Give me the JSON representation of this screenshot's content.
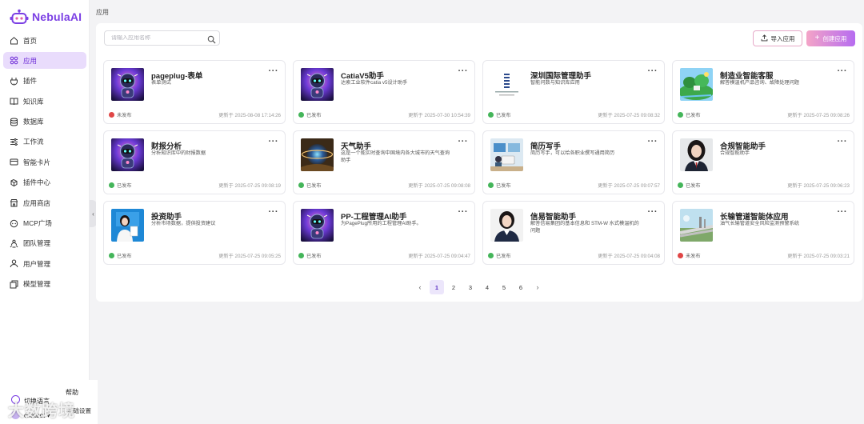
{
  "app": {
    "brand": "NebulaAI"
  },
  "sidebar": {
    "items": [
      {
        "label": "首页",
        "icon": "home-icon",
        "active": false
      },
      {
        "label": "应用",
        "icon": "apps-icon",
        "active": true
      },
      {
        "label": "插件",
        "icon": "plug-icon",
        "active": false
      },
      {
        "label": "知识库",
        "icon": "book-icon",
        "active": false
      },
      {
        "label": "数据库",
        "icon": "database-icon",
        "active": false
      },
      {
        "label": "工作流",
        "icon": "workflow-icon",
        "active": false
      },
      {
        "label": "智能卡片",
        "icon": "card-icon",
        "active": false
      },
      {
        "label": "插件中心",
        "icon": "plugin-center-icon",
        "active": false
      },
      {
        "label": "应用商店",
        "icon": "store-icon",
        "active": false
      },
      {
        "label": "MCP广场",
        "icon": "mcp-icon",
        "active": false
      },
      {
        "label": "团队管理",
        "icon": "team-icon",
        "active": false
      },
      {
        "label": "用户管理",
        "icon": "user-icon",
        "active": false
      },
      {
        "label": "模型管理",
        "icon": "model-icon",
        "active": false
      }
    ],
    "help_label": "帮助",
    "language_label": "切换语言",
    "user_name": "chatbot",
    "settings_label": "基础设置"
  },
  "watermark": "大数跨境",
  "breadcrumb": "应用",
  "search": {
    "placeholder": "请输入应用名称"
  },
  "toolbar": {
    "import_label": "导入应用",
    "create_label": "创建应用"
  },
  "colors": {
    "brand": "#7b3fe4",
    "published": "#44b55a",
    "unpublished": "#e04646",
    "active_nav_bg": "#e9dcfc"
  },
  "cards": [
    {
      "title": "pageplug-表单",
      "desc": "表单测试",
      "status": "未发布",
      "published": false,
      "updated": "更新于 2025-08-08 17:14:26",
      "image": "robot"
    },
    {
      "title": "CatiaV5助手",
      "desc": "达索工业软件catia v5设计助手",
      "status": "已发布",
      "published": true,
      "updated": "更新于 2025-07-30 10:54:39",
      "image": "robot"
    },
    {
      "title": "深圳国际管理助手",
      "desc": "智能问数与知识库应用",
      "status": "已发布",
      "published": true,
      "updated": "更新于 2025-07-25 09:08:32",
      "image": "building-logo"
    },
    {
      "title": "制造业智能客服",
      "desc": "解答模温机产品咨询、故障处理问题",
      "status": "已发布",
      "published": true,
      "updated": "更新于 2025-07-25 09:08:26",
      "image": "landscape"
    },
    {
      "title": "财报分析",
      "desc": "分析知识库中的财报数据",
      "status": "已发布",
      "published": true,
      "updated": "更新于 2025-07-25 09:08:19",
      "image": "robot"
    },
    {
      "title": "天气助手",
      "desc": "这是一个能实时查询中国境内各大城市的天气查询助手",
      "status": "已发布",
      "published": true,
      "updated": "更新于 2025-07-25 09:08:08",
      "image": "planet"
    },
    {
      "title": "简历写手",
      "desc": "简历写手，可以给各职业撰写通用简历",
      "status": "已发布",
      "published": true,
      "updated": "更新于 2025-07-25 09:07:57",
      "image": "office"
    },
    {
      "title": "合规智能助手",
      "desc": "合规智能助手",
      "status": "已发布",
      "published": true,
      "updated": "更新于 2025-07-25 09:06:23",
      "image": "portrait"
    },
    {
      "title": "投资助手",
      "desc": "分析市场数据，提供投资建议",
      "status": "已发布",
      "published": true,
      "updated": "更新于 2025-07-25 09:05:25",
      "image": "presenter"
    },
    {
      "title": "PP-工程管理AI助手",
      "desc": "为PagePlug所用的工程管理AI助手。",
      "status": "已发布",
      "published": true,
      "updated": "更新于 2025-07-25 09:04:47",
      "image": "robot"
    },
    {
      "title": "信易智能助手",
      "desc": "解答信易集团的基本信息和 STM-W 水式模温机的问题",
      "status": "已发布",
      "published": true,
      "updated": "更新于 2025-07-25 09:04:08",
      "image": "portrait2"
    },
    {
      "title": "长输管道智能体应用",
      "desc": "油气长输管道安全风险监测预警系统",
      "status": "未发布",
      "published": false,
      "updated": "更新于 2025-07-25 09:03:21",
      "image": "pipeline"
    }
  ],
  "pagination": {
    "pages": [
      "1",
      "2",
      "3",
      "4",
      "5",
      "6"
    ],
    "current": "1"
  }
}
